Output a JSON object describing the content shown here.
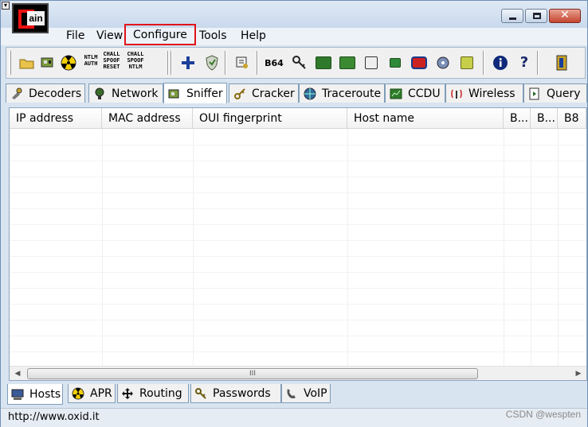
{
  "window": {
    "app_logo_text": "ain"
  },
  "menu": {
    "file": "File",
    "view": "View",
    "configure": "Configure",
    "tools": "Tools",
    "help": "Help",
    "highlight_color": "#e0141b"
  },
  "toolbar": {
    "ntlm_auth": [
      "NTLM",
      "AUTH"
    ],
    "chall_spoof_reset": [
      "CHALL",
      "SPOOF",
      "RESET"
    ],
    "chall_spoof_ntlm": [
      "CHALL",
      "SPOOF",
      "NTLM"
    ],
    "b64_label": "B64",
    "icons": [
      "open-folder-icon",
      "network-card-icon",
      "radiation-icon",
      "ntlm-auth-icon",
      "chall-spoof-reset-icon",
      "chall-spoof-ntlm-icon",
      "add-icon",
      "shield-icon",
      "resolve-icon",
      "base64-icon",
      "key-icon",
      "lsa-secrets-icon",
      "vpn-icon",
      "rc-icon",
      "box-icon",
      "terminal-server-icon",
      "wireless-icon",
      "password-icon",
      "info-icon",
      "help-icon",
      "exit-icon"
    ]
  },
  "tabs": [
    {
      "label": "Decoders",
      "icon": "decoder-icon"
    },
    {
      "label": "Network",
      "icon": "network-icon"
    },
    {
      "label": "Sniffer",
      "icon": "sniffer-icon"
    },
    {
      "label": "Cracker",
      "icon": "cracker-icon"
    },
    {
      "label": "Traceroute",
      "icon": "traceroute-icon"
    },
    {
      "label": "CCDU",
      "icon": "ccdu-icon"
    },
    {
      "label": "Wireless",
      "icon": "wireless-icon"
    },
    {
      "label": "Query",
      "icon": "query-icon"
    }
  ],
  "active_tab": "Sniffer",
  "table": {
    "columns": [
      "IP address",
      "MAC address",
      "OUI fingerprint",
      "Host name",
      "B...",
      "B...",
      "B8"
    ],
    "rows": []
  },
  "scrollbar": {
    "thumb_grip": "III"
  },
  "bottom_tabs": [
    {
      "label": "Hosts",
      "icon": "hosts-icon"
    },
    {
      "label": "APR",
      "icon": "apr-icon"
    },
    {
      "label": "Routing",
      "icon": "routing-icon"
    },
    {
      "label": "Passwords",
      "icon": "passwords-icon"
    },
    {
      "label": "VoIP",
      "icon": "voip-icon"
    }
  ],
  "active_bottom_tab": "Hosts",
  "status": {
    "url": "http://www.oxid.it"
  },
  "watermark": "CSDN @wespten"
}
